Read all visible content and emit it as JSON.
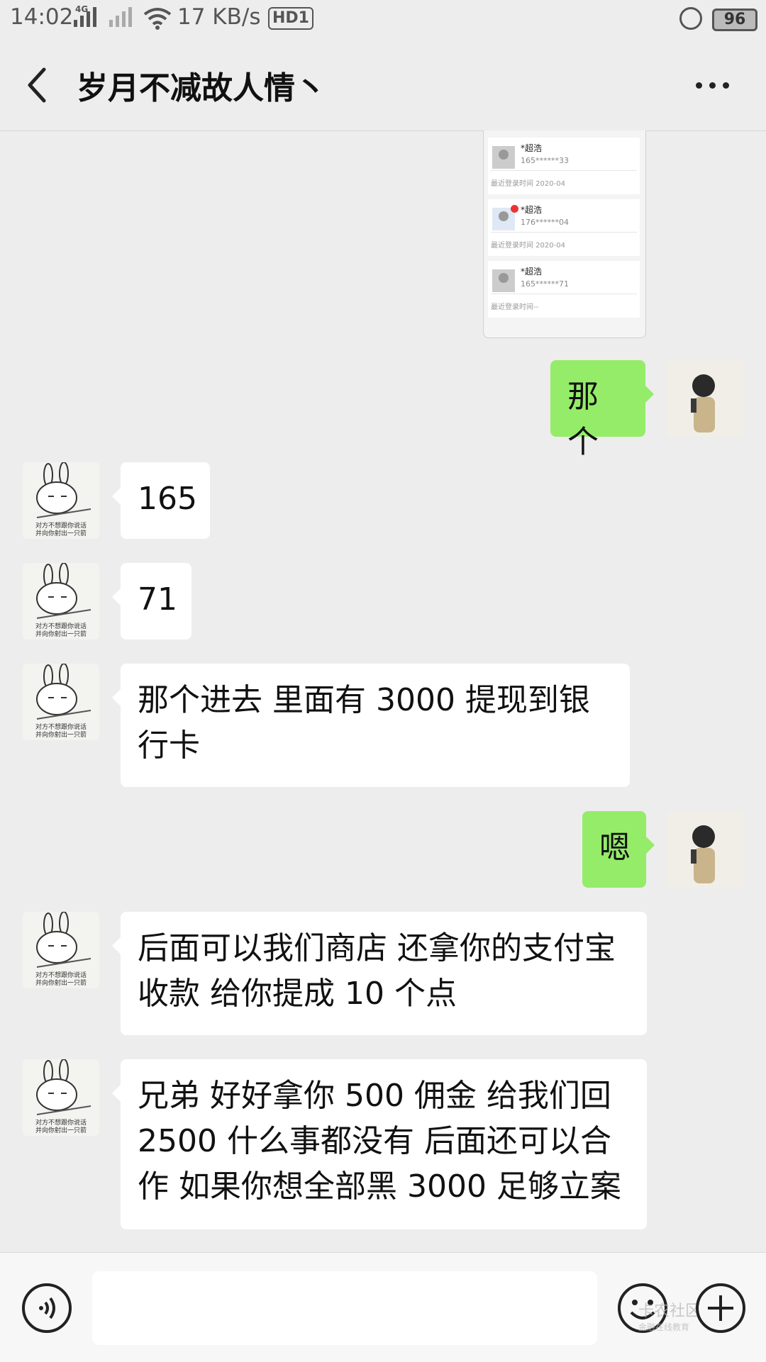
{
  "status_bar": {
    "time": "14:02",
    "network": "4G",
    "speed": "17 KB/s",
    "hd": "HD1",
    "battery": "96"
  },
  "header": {
    "title": "岁月不减故人情丶"
  },
  "shared_image": {
    "accounts": [
      {
        "name": "*超浩",
        "phone": "165******33",
        "last_login": "最近登录时间 2020-04"
      },
      {
        "name": "*超浩",
        "phone": "176******04",
        "last_login": "最近登录时间 2020-04"
      },
      {
        "name": "*超浩",
        "phone": "165******71",
        "last_login": "最近登录时间--"
      }
    ]
  },
  "messages": [
    {
      "side": "right",
      "text": "那个"
    },
    {
      "side": "left",
      "text": "165"
    },
    {
      "side": "left",
      "text": "71"
    },
    {
      "side": "left",
      "text": "那个进去 里面有 3000 提现到银行卡"
    },
    {
      "side": "right",
      "text": "嗯"
    },
    {
      "side": "left",
      "text": "后面可以我们商店 还拿你的支付宝收款 给你提成 10 个点"
    },
    {
      "side": "left",
      "text": "兄弟 好好拿你 500 佣金 给我们回 2500 什么事都没有 后面还可以合作   如果你想全部黑 3000 足够立案"
    }
  ],
  "input_bar": {
    "placeholder": "",
    "value": ""
  },
  "sticker_avatar_caption": [
    "对方不想跟你说话",
    "并向你射出一只箭"
  ],
  "watermark": {
    "line1": "卡农社区",
    "line2": "金融在线教育"
  },
  "colors": {
    "sent_bubble": "#95ec69",
    "received_bubble": "#ffffff",
    "background": "#ededed"
  }
}
